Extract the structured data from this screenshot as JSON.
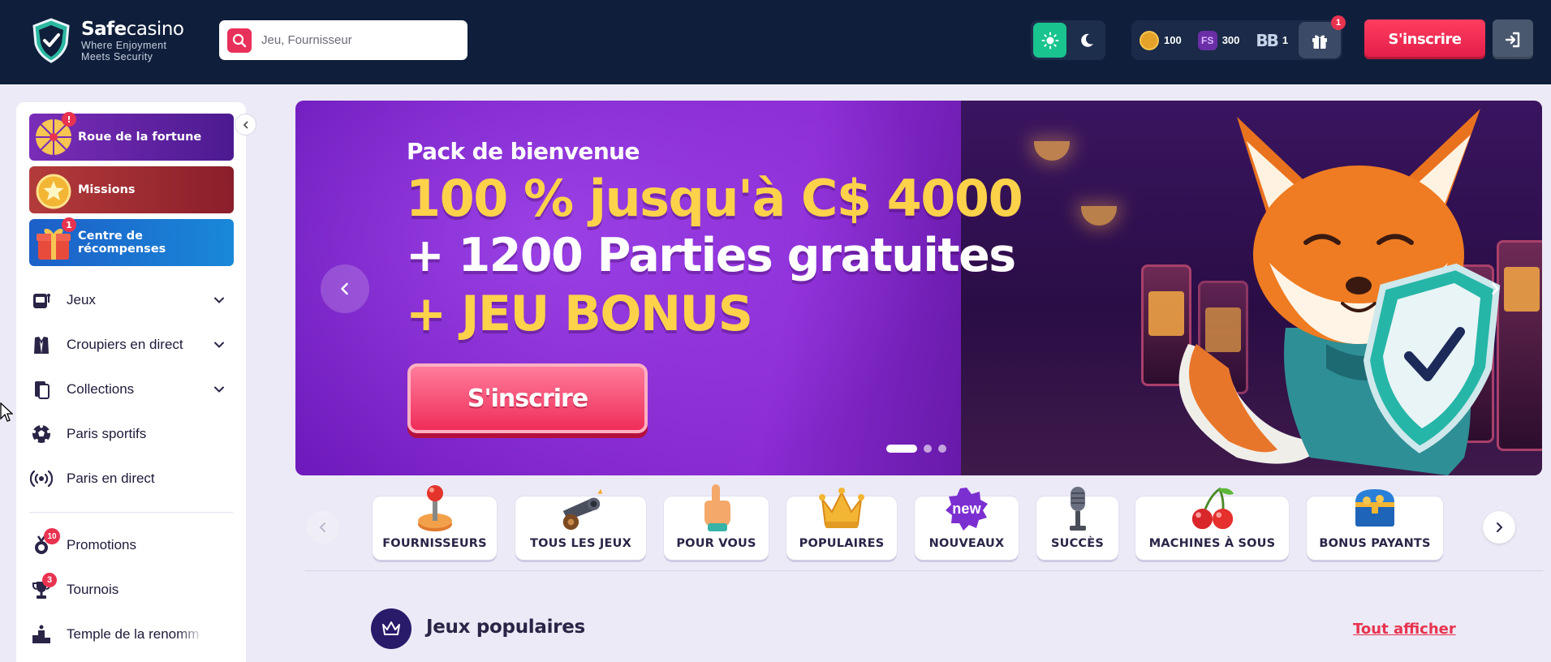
{
  "header": {
    "logo_name_bold": "Safe",
    "logo_name_rest": "casino",
    "logo_tagline_1": "Where Enjoyment",
    "logo_tagline_2": "Meets Security",
    "search_placeholder": "Jeu, Fournisseur",
    "wallet": {
      "coins": "100",
      "free_spins_label": "FS",
      "free_spins": "300",
      "bonus_buys_label": "BB",
      "bonus_buys": "1"
    },
    "gift_badge": "1",
    "signup_label": "S'inscrire"
  },
  "sidebar": {
    "cards": [
      {
        "label": "Roue de la fortune",
        "badge": "!"
      },
      {
        "label": "Missions"
      },
      {
        "label": "Centre de récompenses",
        "badge": "1"
      }
    ],
    "items": [
      {
        "label": "Jeux"
      },
      {
        "label": "Croupiers en direct"
      },
      {
        "label": "Collections"
      },
      {
        "label": "Paris sportifs"
      },
      {
        "label": "Paris en direct"
      },
      {
        "label": "Promotions",
        "badge": "10"
      },
      {
        "label": "Tournois",
        "badge": "3"
      },
      {
        "label": "Temple de la renomm"
      }
    ]
  },
  "banner": {
    "pre_title": "Pack de bienvenue",
    "line1": "100 % jusqu'à C$ 4000",
    "line2": "+ 1200 Parties gratuites",
    "line3": "+ JEU BONUS",
    "cta": "S'inscrire",
    "slides": 3,
    "active_slide": 1
  },
  "categories": [
    {
      "label": "FOURNISSEURS",
      "icon": "joystick-icon"
    },
    {
      "label": "TOUS LES JEUX",
      "icon": "cannon-icon"
    },
    {
      "label": "POUR VOUS",
      "icon": "pointing-hand-icon"
    },
    {
      "label": "POPULAIRES",
      "icon": "crown-icon"
    },
    {
      "label": "NOUVEAUX",
      "icon": "new-badge-icon",
      "icon_text": "new"
    },
    {
      "label": "SUCCÈS",
      "icon": "microphone-icon"
    },
    {
      "label": "MACHINES À SOUS",
      "icon": "cherries-icon"
    },
    {
      "label": "BONUS PAYANTS",
      "icon": "treasure-chest-icon"
    }
  ],
  "popular": {
    "title": "Jeux populaires",
    "see_all": "Tout afficher"
  },
  "colors": {
    "header_bg": "#0f1f3b",
    "accent_red": "#e8334f",
    "theme_active": "#19c48e",
    "banner_yellow": "#fcd24a"
  }
}
